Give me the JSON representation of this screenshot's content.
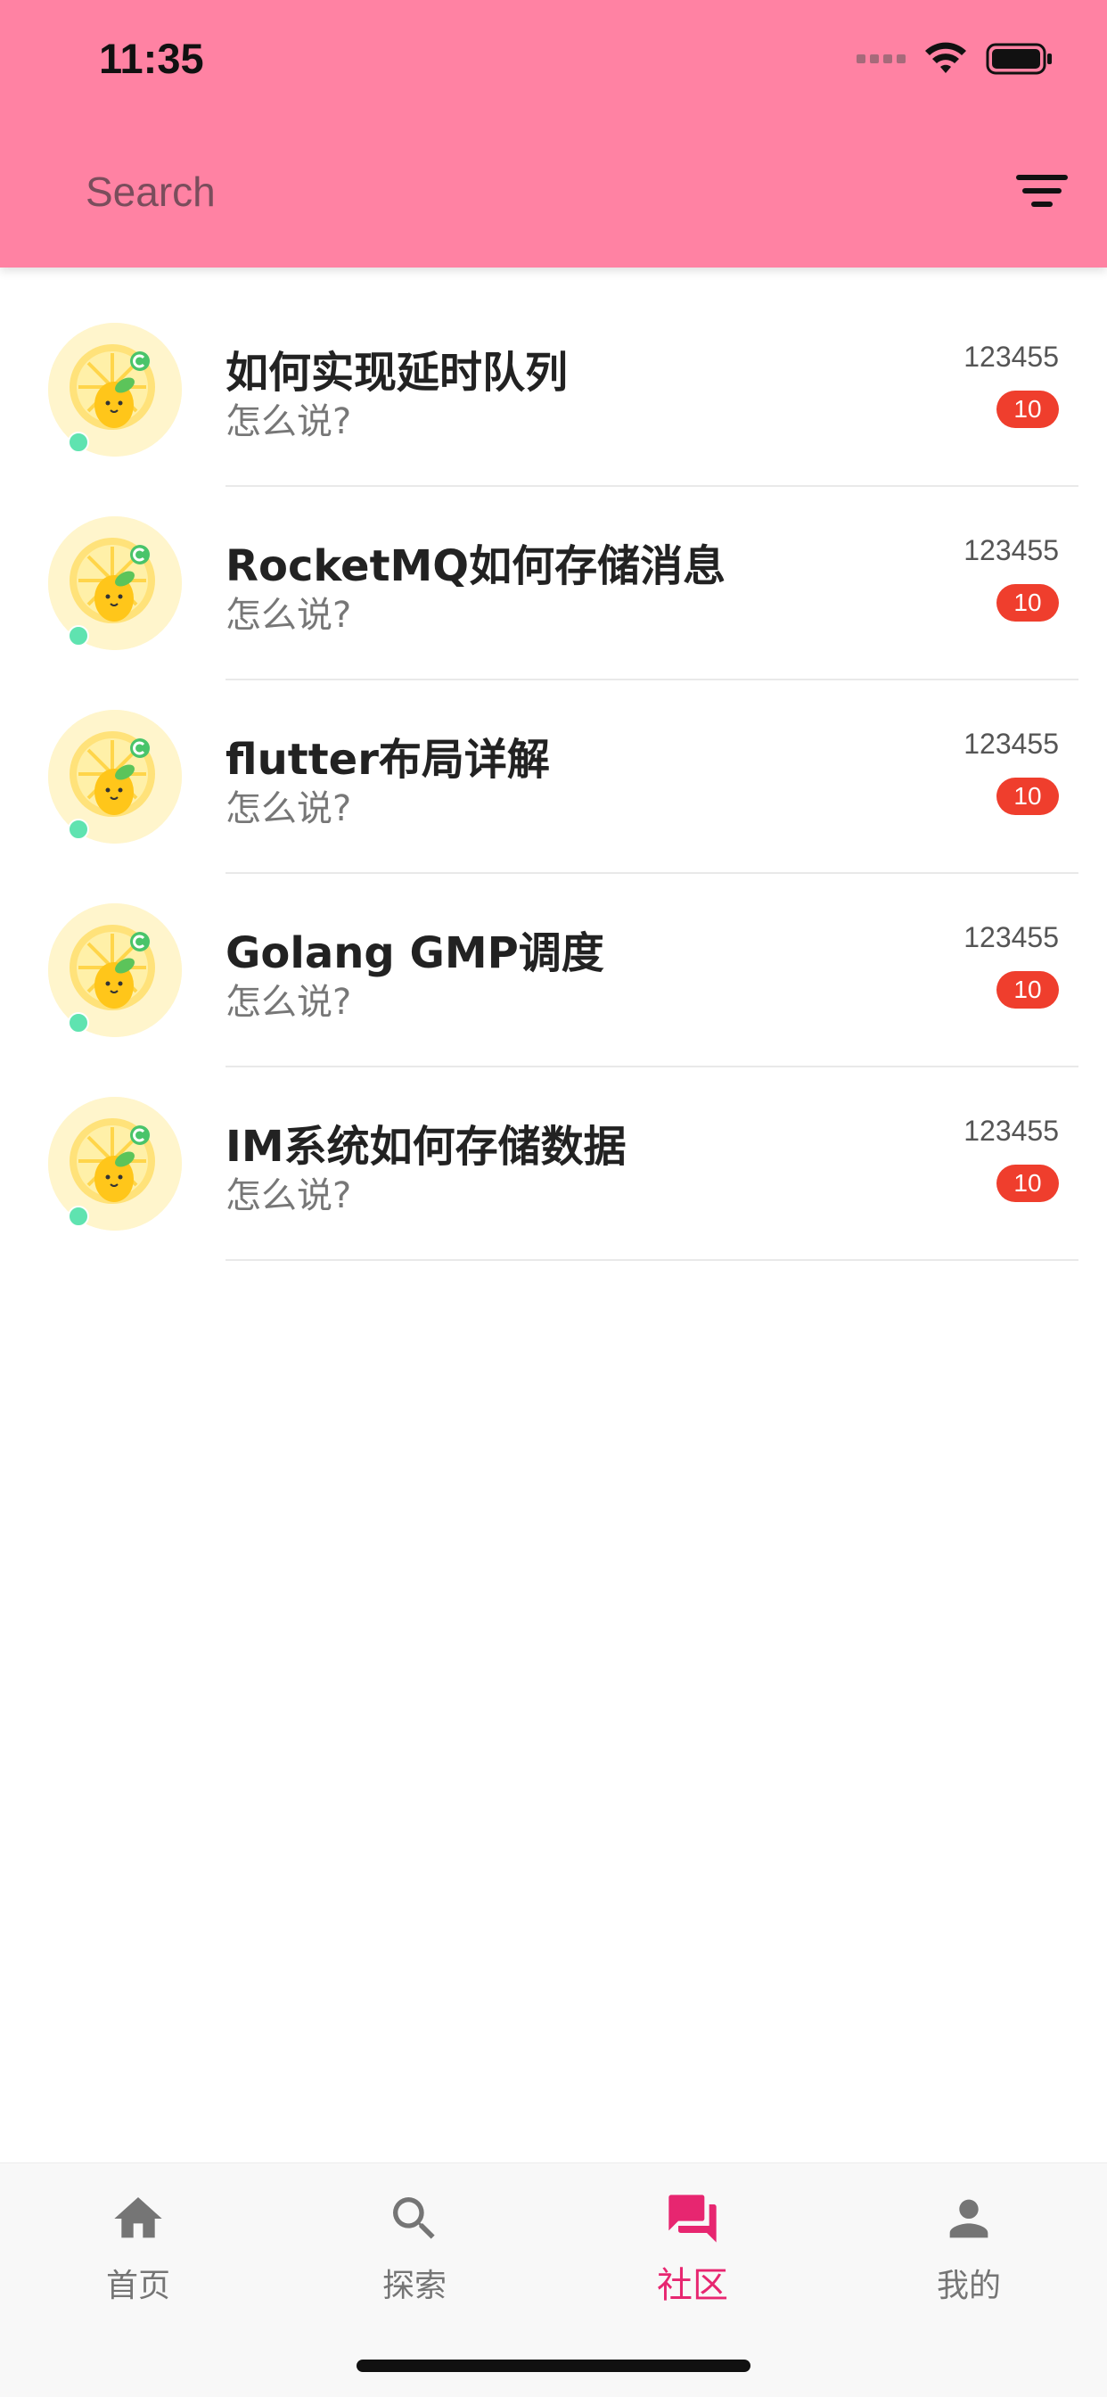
{
  "status_bar": {
    "time": "11:35"
  },
  "header": {
    "search_placeholder": "Search",
    "filter_icon": "filter-icon",
    "background_color": "#ff82a3"
  },
  "conversations": [
    {
      "title": "如何实现延时队列",
      "subtitle": "怎么说?",
      "time": "123455",
      "unread": "10"
    },
    {
      "title": "RocketMQ如何存储消息",
      "subtitle": "怎么说?",
      "time": "123455",
      "unread": "10"
    },
    {
      "title": "flutter布局详解",
      "subtitle": "怎么说?",
      "time": "123455",
      "unread": "10"
    },
    {
      "title": "Golang GMP调度",
      "subtitle": "怎么说?",
      "time": "123455",
      "unread": "10"
    },
    {
      "title": "IM系统如何存储数据",
      "subtitle": "怎么说?",
      "time": "123455",
      "unread": "10"
    }
  ],
  "bottom_nav": {
    "items": [
      {
        "label": "首页",
        "icon": "home-icon",
        "active": false
      },
      {
        "label": "探索",
        "icon": "search-icon",
        "active": false
      },
      {
        "label": "社区",
        "icon": "forum-icon",
        "active": true
      },
      {
        "label": "我的",
        "icon": "person-icon",
        "active": false
      }
    ],
    "active_color": "#e72670",
    "inactive_color": "#757575"
  },
  "colors": {
    "badge": "#ef3e2d",
    "online": "#5fe3b0"
  }
}
